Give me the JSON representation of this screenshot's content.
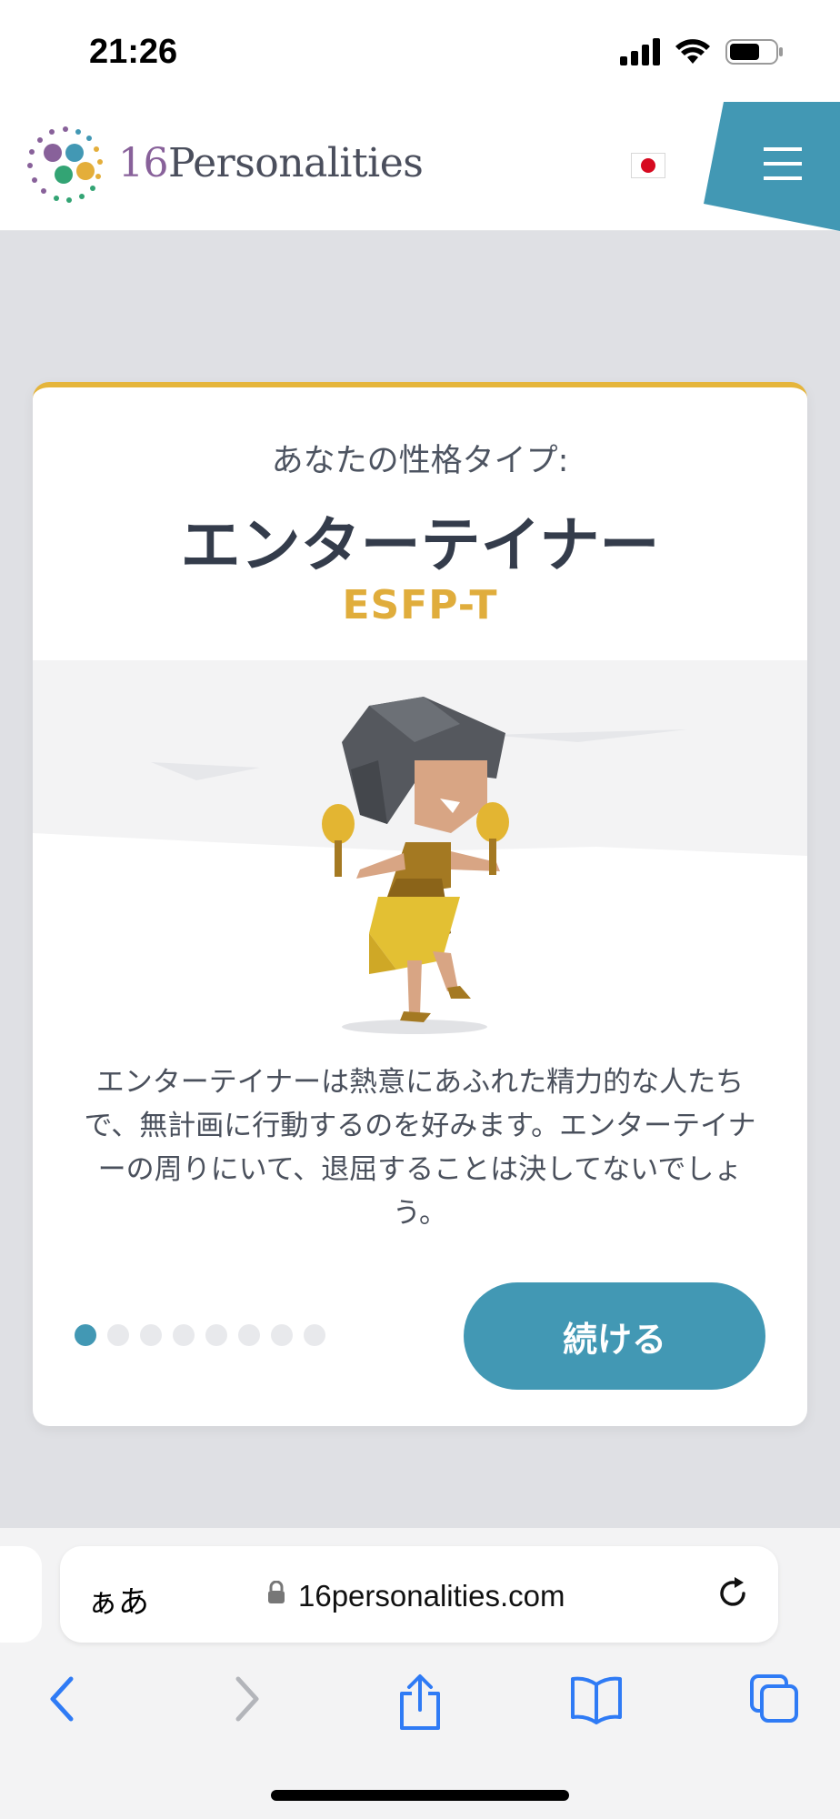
{
  "status_bar": {
    "time": "21:26"
  },
  "header": {
    "logo_num": "16",
    "logo_text": "Personalities",
    "language_flag": "japan-flag-icon",
    "menu_icon": "hamburger-menu-icon"
  },
  "card": {
    "subtitle": "あなたの性格タイプ:",
    "title": "エンターテイナー",
    "code": "ESFP-T",
    "description": "エンターテイナーは熱意にあふれた精力的な人たちで、無計画に行動するのを好みます。エンターテイナーの周りにいて、退屈することは決してないでしょう。",
    "pager": {
      "total": 8,
      "active": 1
    },
    "continue_label": "続ける"
  },
  "browser": {
    "text_size_label": "ぁあ",
    "url": "16personalities.com"
  },
  "colors": {
    "accent": "#4298b4",
    "gold": "#e0ad3c",
    "title_text": "#343c4b"
  }
}
